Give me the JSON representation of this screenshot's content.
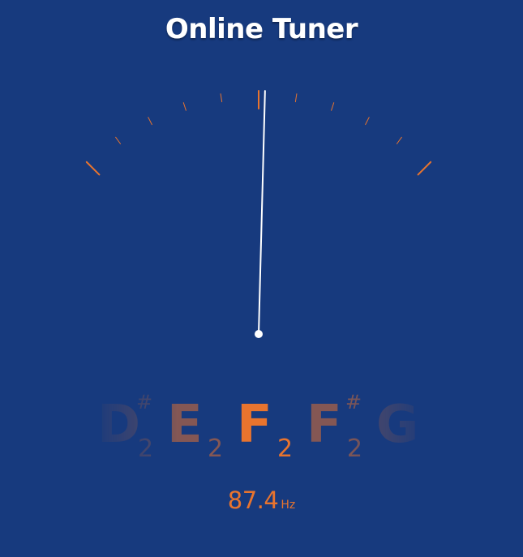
{
  "app": {
    "title": "Online Tuner"
  },
  "meter": {
    "tick_count": 11,
    "needle_deflection_degrees": 1.5,
    "tick_color": "#e8742e",
    "needle_color": "#ffffff"
  },
  "notes": [
    {
      "letter": "D",
      "sharp": "#",
      "octave": "2",
      "state": "dim-far"
    },
    {
      "letter": "E",
      "sharp": "",
      "octave": "2",
      "state": "dim-near"
    },
    {
      "letter": "F",
      "sharp": "",
      "octave": "2",
      "state": "active"
    },
    {
      "letter": "F",
      "sharp": "#",
      "octave": "2",
      "state": "dim-near"
    },
    {
      "letter": "G",
      "sharp": "",
      "octave": "",
      "state": "dim-far"
    }
  ],
  "readout": {
    "frequency": "87.4",
    "unit": "Hz"
  },
  "colors": {
    "background": "#173a7e",
    "accent": "#e8742e",
    "title": "#ffffff"
  }
}
